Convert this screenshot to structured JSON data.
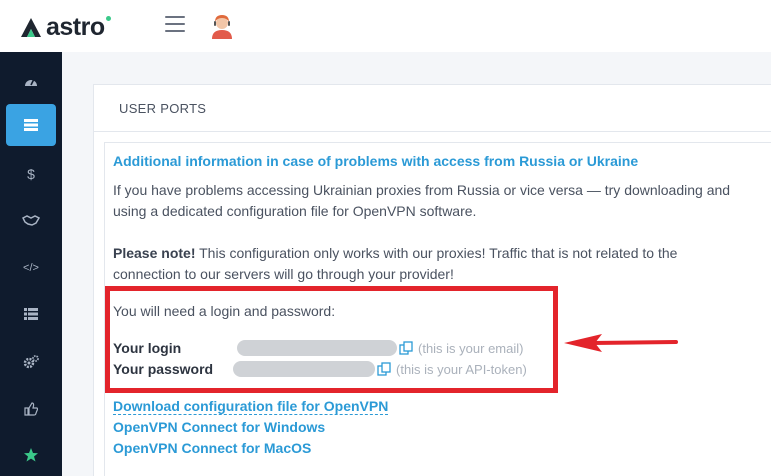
{
  "header": {
    "logo_text": "astro",
    "menu_icon": "hamburger-icon",
    "avatar_icon": "support-agent-icon"
  },
  "sidebar": {
    "items": [
      {
        "icon": "dashboard-icon"
      },
      {
        "icon": "server-icon",
        "active": true
      },
      {
        "icon": "dollar-icon",
        "glyph": "$"
      },
      {
        "icon": "handshake-icon"
      },
      {
        "icon": "code-icon",
        "glyph": "</>"
      },
      {
        "icon": "list-icon"
      },
      {
        "icon": "gears-icon"
      },
      {
        "icon": "thumbs-up-icon"
      },
      {
        "icon": "star-icon"
      }
    ]
  },
  "card": {
    "title": "USER PORTS"
  },
  "info": {
    "title": "Additional information in case of problems with access from Russia or Ukraine",
    "para1_line1": "If you have problems accessing Ukrainian proxies from Russia or vice versa — try downloading and",
    "para1_line2": "using a dedicated configuration file for OpenVPN software.",
    "note_bold": "Please note!",
    "note_line1": " This configuration only works with our proxies! Traffic that is not related to the",
    "note_line2": "connection to our servers will go through your provider!",
    "login_intro": "You will need a login and password:",
    "login_label": "Your login",
    "login_hint": "(this is your email)",
    "password_label": "Your password",
    "password_hint": "(this is your API-token)"
  },
  "links": {
    "download": "Download configuration file for OpenVPN",
    "windows": "OpenVPN Connect for Windows",
    "macos": "OpenVPN Connect for MacOS"
  },
  "colors": {
    "accent": "#2b9ad6",
    "sidebar_bg": "#0f1b2d",
    "active_item": "#3aa3e3",
    "highlight_red": "#e3242b"
  }
}
